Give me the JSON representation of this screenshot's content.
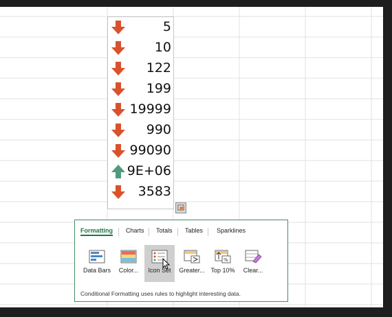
{
  "values": [
    "5",
    "10",
    "122",
    "199",
    "19999",
    "990",
    "99090",
    "9E+06",
    "3583"
  ],
  "icons": [
    "arrow-down-red",
    "arrow-down-red",
    "arrow-down-red",
    "arrow-down-red",
    "arrow-down-red",
    "arrow-down-red",
    "arrow-down-red",
    "arrow-up-green",
    "arrow-down-red"
  ],
  "colors": {
    "down": "#d9522c",
    "up": "#4f9a7d",
    "accent": "#217346"
  },
  "tabs": [
    "Formatting",
    "Charts",
    "Totals",
    "Tables",
    "Sparklines"
  ],
  "buttons": [
    "Data Bars",
    "Color...",
    "Icon Set",
    "Greater...",
    "Top 10%",
    "Clear..."
  ],
  "footer": "Conditional Formatting uses rules to highlight interesting data."
}
